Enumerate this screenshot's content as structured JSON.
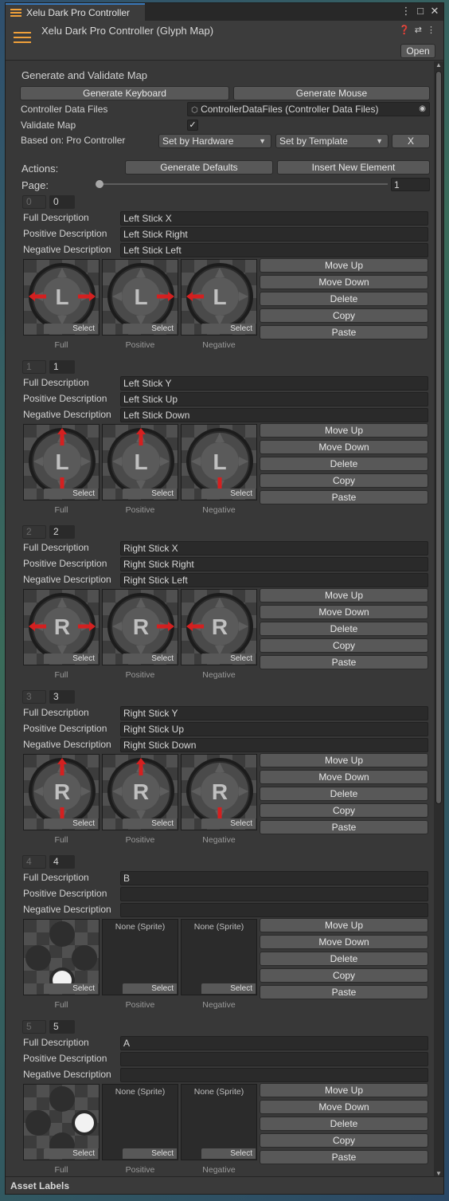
{
  "window": {
    "tab_title": "Xelu Dark Pro Controller",
    "header_title": "Xelu Dark Pro Controller (Glyph Map)",
    "open_label": "Open",
    "icons": [
      "help-icon",
      "presets-icon",
      "more-icon"
    ],
    "tab_icons": [
      "more-icon",
      "maximize-icon",
      "close-icon"
    ]
  },
  "generate": {
    "section_title": "Generate and Validate Map",
    "keyboard_label": "Generate Keyboard",
    "mouse_label": "Generate Mouse",
    "data_files_label": "Controller Data Files",
    "data_files_value": "ControllerDataFiles (Controller Data Files)",
    "validate_label": "Validate Map",
    "validate_checked": true,
    "based_on_label": "Based on: Pro Controller",
    "hardware_value": "Set by Hardware",
    "template_value": "Set by Template",
    "x_label": "X"
  },
  "actions": {
    "label": "Actions:",
    "generate_defaults": "Generate Defaults",
    "insert_new": "Insert New Element",
    "page_label": "Page:",
    "page_value": "1",
    "page_fraction": 0.0
  },
  "labels": {
    "full_desc": "Full Description",
    "pos_desc": "Positive Description",
    "neg_desc": "Negative Description",
    "cap_full": "Full",
    "cap_pos": "Positive",
    "cap_neg": "Negative",
    "select": "Select",
    "none_sprite": "None (Sprite)",
    "move_up": "Move Up",
    "move_down": "Move Down",
    "delete": "Delete",
    "copy": "Copy",
    "paste": "Paste"
  },
  "elements": [
    {
      "index": "0",
      "index_edit": "0",
      "full": "Left Stick X",
      "positive": "Left Stick Right",
      "negative": "Left Stick Left",
      "glyph": "stick",
      "letter": "L",
      "axis": "x"
    },
    {
      "index": "1",
      "index_edit": "1",
      "full": "Left Stick Y",
      "positive": "Left Stick Up",
      "negative": "Left Stick Down",
      "glyph": "stick",
      "letter": "L",
      "axis": "y"
    },
    {
      "index": "2",
      "index_edit": "2",
      "full": "Right Stick X",
      "positive": "Right Stick Right",
      "negative": "Right Stick Left",
      "glyph": "stick",
      "letter": "R",
      "axis": "x"
    },
    {
      "index": "3",
      "index_edit": "3",
      "full": "Right Stick Y",
      "positive": "Right Stick Up",
      "negative": "Right Stick Down",
      "glyph": "stick",
      "letter": "R",
      "axis": "y"
    },
    {
      "index": "4",
      "index_edit": "4",
      "full": "B",
      "positive": "",
      "negative": "",
      "glyph": "face",
      "active": "bottom"
    },
    {
      "index": "5",
      "index_edit": "5",
      "full": "A",
      "positive": "",
      "negative": "",
      "glyph": "face",
      "active": "right"
    }
  ],
  "footer": {
    "label": "Asset Labels"
  },
  "colors": {
    "arrow": "#d42020",
    "accent": "#f0a03a",
    "stick": "#5a5a5a"
  }
}
